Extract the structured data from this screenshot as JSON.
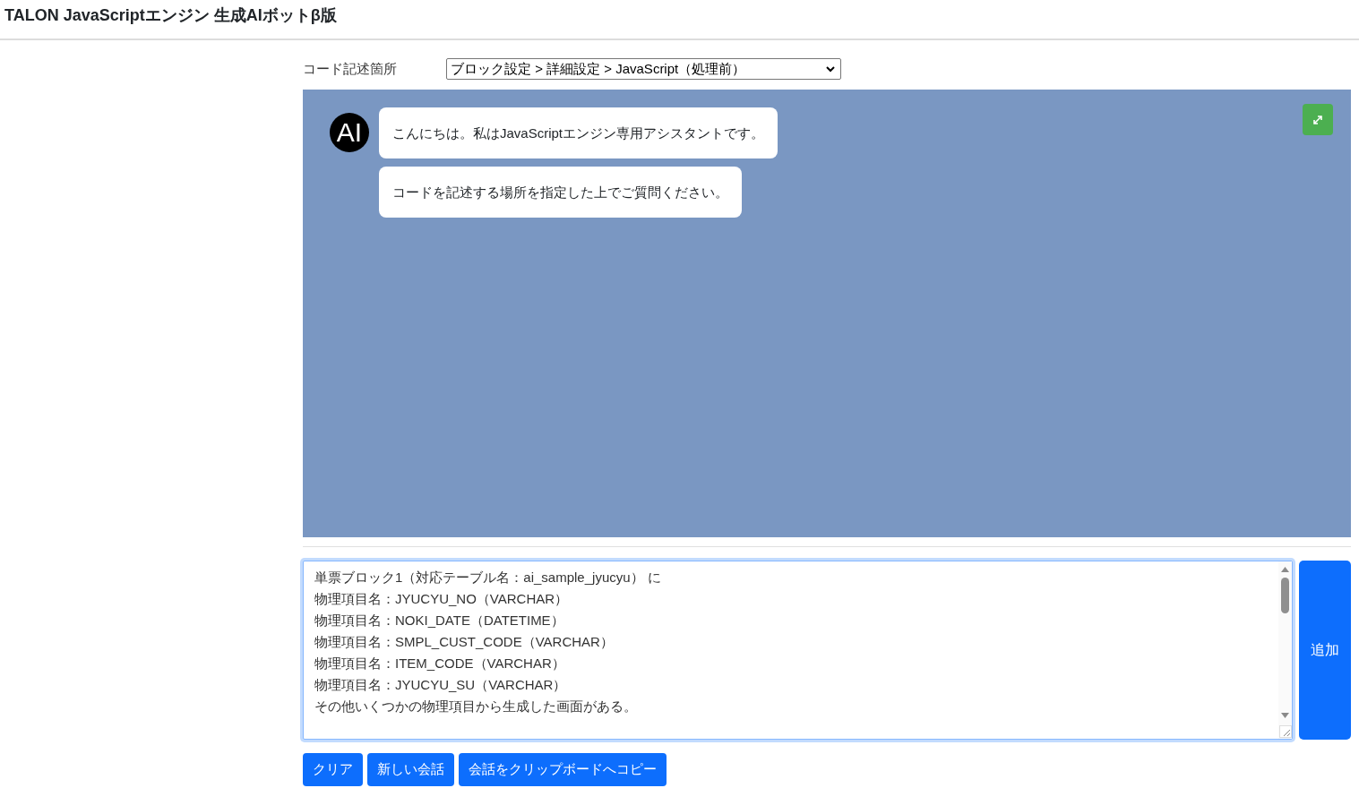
{
  "header": {
    "title": "TALON JavaScriptエンジン 生成AIボットβ版"
  },
  "code_location": {
    "label": "コード記述箇所",
    "value": "ブロック設定 > 詳細設定 > JavaScript（処理前）"
  },
  "chat": {
    "messages": [
      {
        "kind": "bot",
        "avatar": "AI",
        "bubbles": [
          "こんにちは。私はJavaScriptエンジン専用アシスタントです。",
          "コードを記述する場所を指定した上でご質問ください。"
        ]
      }
    ]
  },
  "input": {
    "lines": [
      "単票ブロック1（対応テーブル名：ai_sample_jyucyu） に",
      "物理項目名：JYUCYU_NO（VARCHAR）",
      "物理項目名：NOKI_DATE（DATETIME）",
      "物理項目名：SMPL_CUST_CODE（VARCHAR）",
      "物理項目名：ITEM_CODE（VARCHAR）",
      "物理項目名：JYUCYU_SU（VARCHAR）",
      "その他いくつかの物理項目から生成した画面がある。"
    ]
  },
  "send_button": "追加",
  "buttons": [
    "クリア",
    "新しい会話",
    "会話をクリップボードへコピー"
  ]
}
